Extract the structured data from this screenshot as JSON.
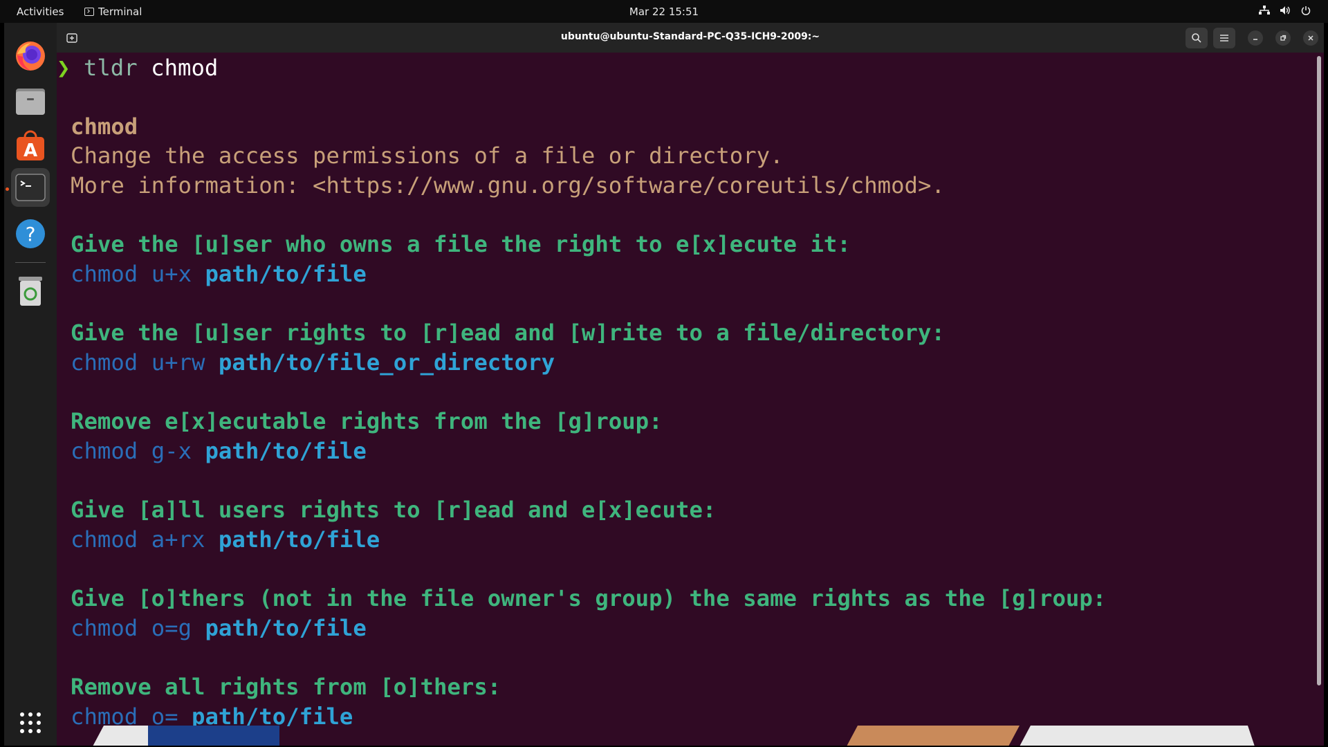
{
  "topbar": {
    "activities": "Activities",
    "app_name": "Terminal",
    "clock": "Mar 22  15:51"
  },
  "dock": {
    "apps": [
      "firefox",
      "files",
      "app-center",
      "terminal",
      "help",
      "trash",
      "show-apps"
    ]
  },
  "window": {
    "title": "ubuntu@ubuntu-Standard-PC-Q35-ICH9-2009:~"
  },
  "terminal": {
    "prompt_symbol": "❯",
    "command": "tldr",
    "command_arg": "chmod",
    "page_name": "chmod",
    "description": "Change the access permissions of a file or directory.",
    "more_info": "More information: <https://www.gnu.org/software/coreutils/chmod>.",
    "examples": [
      {
        "heading": "Give the [u]ser who owns a file the right to e[x]ecute it:",
        "cmd": "chmod",
        "arg": "u+x",
        "path": "path/to/file"
      },
      {
        "heading": "Give the [u]ser rights to [r]ead and [w]rite to a file/directory:",
        "cmd": "chmod",
        "arg": "u+rw",
        "path": "path/to/file_or_directory"
      },
      {
        "heading": "Remove e[x]ecutable rights from the [g]roup:",
        "cmd": "chmod",
        "arg": "g-x",
        "path": "path/to/file"
      },
      {
        "heading": "Give [a]ll users rights to [r]ead and e[x]ecute:",
        "cmd": "chmod",
        "arg": "a+rx",
        "path": "path/to/file"
      },
      {
        "heading": "Give [o]thers (not in the file owner's group) the same rights as the [g]roup:",
        "cmd": "chmod",
        "arg": "o=g",
        "path": "path/to/file"
      },
      {
        "heading": "Remove all rights from [o]thers:",
        "cmd": "chmod",
        "arg": "o=",
        "path": "path/to/file"
      }
    ]
  },
  "colors": {
    "terminal_bg": "#300a24",
    "heading": "#3fb57d",
    "description": "#c8a079",
    "command": "#2a6eb8",
    "path": "#2fa3d6",
    "accent": "#e95420"
  }
}
